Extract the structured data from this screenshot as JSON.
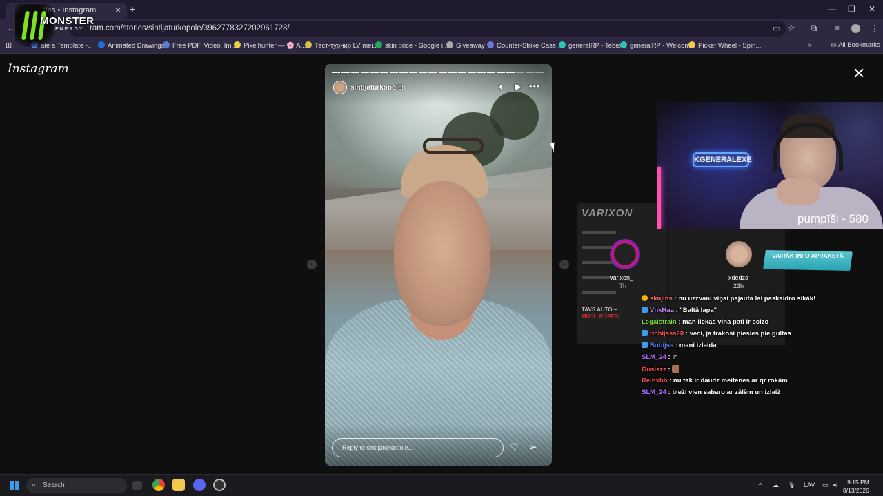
{
  "browser": {
    "tab_title": "stories • Instagram",
    "tab_close": "✕",
    "new_tab": "+",
    "url": "ram.com/stories/sintijaturkopole/3962778327202961728/",
    "window_controls": [
      "—",
      "❐",
      "✕"
    ],
    "bookmarks": [
      {
        "label": "ate a Template -...",
        "color": "#4d89f5"
      },
      {
        "label": "Animated Drawings",
        "color": "#1d6fe0"
      },
      {
        "label": "Free PDF, Video, Im...",
        "color": "#5b7bd5"
      },
      {
        "label": "Pixelhunter — 🌸 A...",
        "color": "#e6d34a"
      },
      {
        "label": "Тест-турнир LV mei...",
        "color": "#d8c14a"
      },
      {
        "label": "skin price - Google i...",
        "color": "#1fae58"
      },
      {
        "label": "Giveaway",
        "color": "#aaaaaa"
      },
      {
        "label": "Counter-Strike Case...",
        "color": "#6b79d8"
      },
      {
        "label": "generalRP - Tebex",
        "color": "#2ec4b6"
      },
      {
        "label": "generalRP - Welcome",
        "color": "#2ec4b6"
      },
      {
        "label": "Picker Wheel - Spin...",
        "color": "#f2c94c"
      }
    ],
    "all_bookmarks": "All Bookmarks"
  },
  "monster": {
    "word": "MONSTER",
    "sub": "ENERGY",
    "accent": "#7de021"
  },
  "instagram": {
    "logo": "Instagram",
    "close": "✕",
    "story": {
      "username": "sintijaturkopole",
      "time": "6h",
      "reply_placeholder": "Reply to sintijaturkopole...",
      "segments_total": 22,
      "segments_done": 19
    },
    "nav_prev": "‹",
    "nav_next": "›"
  },
  "stream": {
    "sign": "KGENERALEXE",
    "counter": "pumpīši - 580",
    "ad_title": "VARIXON",
    "ad_footer1": "TAVS AUTO –",
    "ad_footer2": "MŪSU RŪPES!",
    "info_button": "VAIRĀK INFO APRAKSTĀ",
    "mods": [
      {
        "name": "varixon_",
        "time": "7h"
      },
      {
        "name": "xdedza",
        "time": "23h"
      }
    ],
    "chat": [
      {
        "user": "skujins",
        "user_color": "#ff6b6b",
        "badge": "#f5b800",
        "message": " : nu uzzvani viņai pajauta lai paskaidro sīkāk!"
      },
      {
        "user": "VnkHaa",
        "user_color": "#c58cff",
        "badge": "#3d9be9",
        "message": " : \"Baltā lapa\""
      },
      {
        "user": "Legalstrain",
        "user_color": "#7dd63f",
        "badge": "",
        "message": " : man liekas vina pati ir scizo"
      },
      {
        "user": "richijsss20",
        "user_color": "#ff4f4f",
        "badge": "#3d9be9",
        "message": " : veci, ja trakosi piesies pie gultas"
      },
      {
        "user": "Bobijss",
        "user_color": "#5b8cff",
        "badge": "#3d9be9",
        "message": " : mani izlaida"
      },
      {
        "user": "SLM_24",
        "user_color": "#b36bff",
        "badge": "",
        "message": " : ir"
      },
      {
        "user": "Gusiszz",
        "user_color": "#ff4f4f",
        "badge": "",
        "message": " : "
      },
      {
        "user": "Reinxbb",
        "user_color": "#ff4f4f",
        "badge": "",
        "message": " : nu tak ir daudz meitenes ar qr rokām"
      },
      {
        "user": "SLM_24",
        "user_color": "#b36bff",
        "badge": "",
        "message": " : bieži vien sabaro ar zālēm un izlaiž"
      }
    ]
  },
  "taskbar": {
    "search": "Search",
    "language": "LAV",
    "time": "9:15 PM",
    "date": "8/13/2026"
  }
}
